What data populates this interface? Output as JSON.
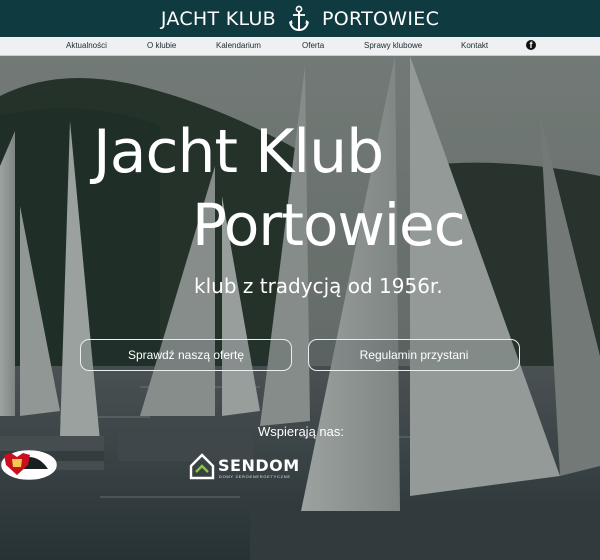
{
  "header": {
    "brand_left": "JACHT KLUB",
    "brand_right": "PORTOWIEC",
    "anchor_icon": "anchor-icon"
  },
  "nav": {
    "items": [
      "Aktualności",
      "O klubie",
      "Kalendarium",
      "Oferta",
      "Sprawy klubowe",
      "Kontakt"
    ],
    "social_icon": "facebook-icon"
  },
  "hero": {
    "title_line1": "Jacht Klub",
    "title_line2": "Portowiec",
    "tagline": "klub z tradycją od 1956r.",
    "buttons": [
      "Sprawdź naszą ofertę",
      "Regulamin przystani"
    ],
    "supporters_label": "Wspierają nas:"
  },
  "sponsors": {
    "sendom_name": "SENDOM",
    "sendom_tagline": "DOMY ZEROENERGETYCZNE"
  },
  "colors": {
    "header_bg": "#0e3a40",
    "nav_bg": "#eef0f2",
    "text_light": "#ffffff",
    "sendom_green": "#8cc63f",
    "sponsor_red": "#c8101e"
  }
}
